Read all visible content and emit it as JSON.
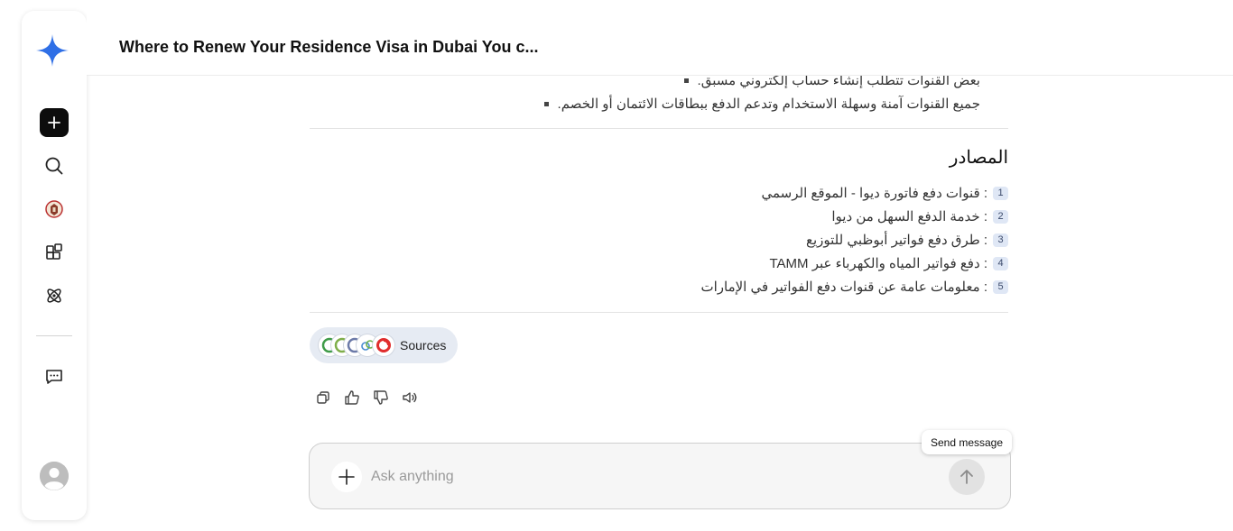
{
  "header": {
    "title": "Where to Renew Your Residence Visa in Dubai You c..."
  },
  "answer": {
    "bullets": [
      "بعض القنوات تتطلب إنشاء حساب إلكتروني مسبق.",
      "جميع القنوات آمنة وسهلة الاستخدام وتدعم الدفع ببطاقات الائتمان أو الخصم."
    ],
    "sources_heading": "المصادر",
    "sources": [
      {
        "num": "1",
        "text": ": قنوات دفع فاتورة ديوا - الموقع الرسمي"
      },
      {
        "num": "2",
        "text": ": خدمة الدفع السهل من ديوا"
      },
      {
        "num": "3",
        "text": ": طرق دفع فواتير أبوظبي للتوزيع"
      },
      {
        "num": "4",
        "text": ": دفع فواتير المياه والكهرباء عبر TAMM"
      },
      {
        "num": "5",
        "text": ": معلومات عامة عن قنوات دفع الفواتير في الإمارات"
      }
    ]
  },
  "sources_pill": {
    "label": "Sources"
  },
  "tooltip": {
    "text": "Send message"
  },
  "composer": {
    "placeholder": "Ask anything"
  },
  "colors": {
    "accent": "#2f6fe6",
    "sidebar_new_bg": "#0d0d0d"
  },
  "icons": [
    "app-logo-icon",
    "new-chat-icon",
    "search-icon",
    "emblem-icon",
    "apps-icon",
    "atom-icon",
    "chat-history-icon",
    "copy-icon",
    "thumbs-up-icon",
    "thumbs-down-icon",
    "speaker-icon",
    "plus-icon",
    "arrow-up-icon"
  ]
}
